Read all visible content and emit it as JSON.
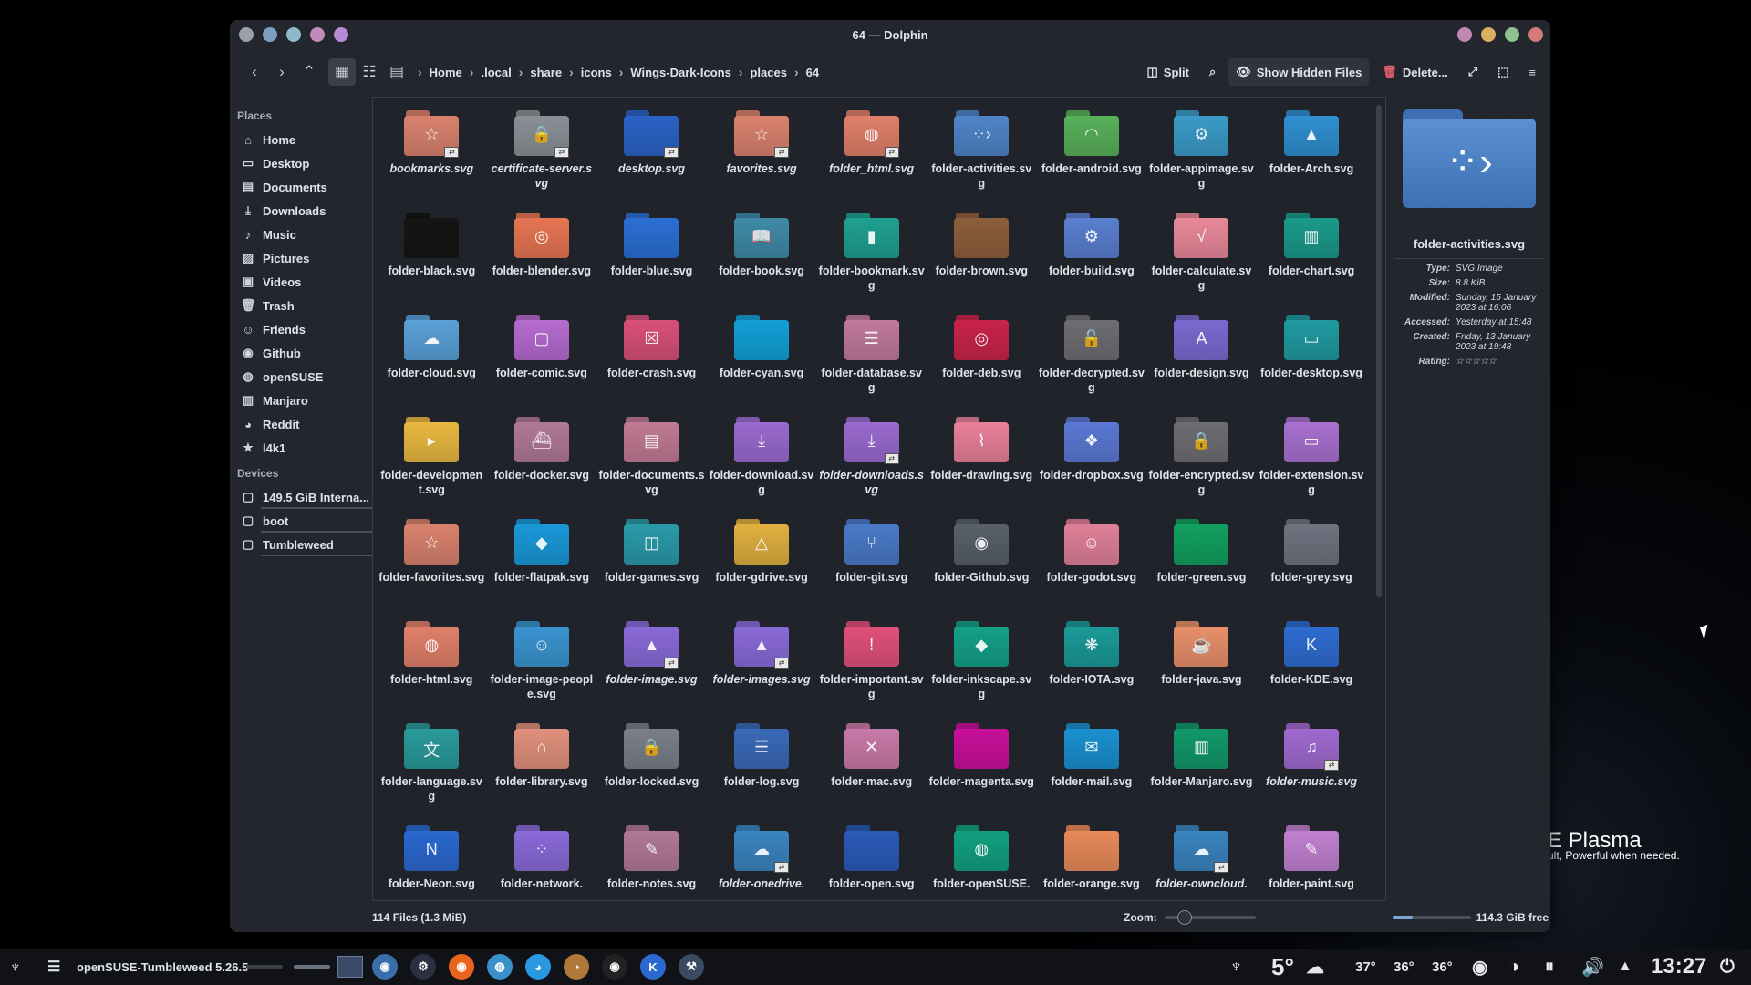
{
  "window": {
    "title": "64 — Dolphin",
    "dots": [
      "#9aa0a8",
      "#7d9fc2",
      "#8fb9c9",
      "#c08bb8",
      "#b48ad9"
    ],
    "controls": [
      "#c088b3",
      "#d8b060",
      "#8fc08f",
      "#d47a7a"
    ]
  },
  "toolbar": {
    "breadcrumbs": [
      "Home",
      ".local",
      "share",
      "icons",
      "Wings-Dark-Icons",
      "places",
      "64"
    ],
    "split": "Split",
    "hidden": "Show Hidden Files",
    "delete": "Delete..."
  },
  "sidebar": {
    "places_header": "Places",
    "places": [
      {
        "label": "Home",
        "icon": "⌂",
        "icon_name": "home-icon"
      },
      {
        "label": "Desktop",
        "icon": "▭",
        "icon_name": "desktop-icon"
      },
      {
        "label": "Documents",
        "icon": "▤",
        "icon_name": "documents-icon"
      },
      {
        "label": "Downloads",
        "icon": "⤓",
        "icon_name": "download-icon"
      },
      {
        "label": "Music",
        "icon": "♪",
        "icon_name": "music-icon"
      },
      {
        "label": "Pictures",
        "icon": "▨",
        "icon_name": "pictures-icon"
      },
      {
        "label": "Videos",
        "icon": "▣",
        "icon_name": "videos-icon"
      },
      {
        "label": "Trash",
        "icon": "🗑",
        "icon_name": "trash-icon"
      },
      {
        "label": "Friends",
        "icon": "☺",
        "icon_name": "friends-icon"
      },
      {
        "label": "Github",
        "icon": "◉",
        "icon_name": "github-icon"
      },
      {
        "label": "openSUSE",
        "icon": "◍",
        "icon_name": "opensuse-icon"
      },
      {
        "label": "Manjaro",
        "icon": "▥",
        "icon_name": "manjaro-icon"
      },
      {
        "label": "Reddit",
        "icon": "◕",
        "icon_name": "reddit-icon"
      },
      {
        "label": "l4k1",
        "icon": "★",
        "icon_name": "star-icon"
      }
    ],
    "devices_header": "Devices",
    "devices": [
      {
        "label": "149.5 GiB Interna...",
        "icon": "▢",
        "icon_name": "drive-icon"
      },
      {
        "label": "boot",
        "icon": "▢",
        "icon_name": "drive-icon"
      },
      {
        "label": "Tumbleweed",
        "icon": "▢",
        "icon_name": "drive-icon"
      }
    ]
  },
  "files": [
    {
      "name": "bookmarks.svg",
      "color": "#d9826e",
      "glyph": "☆",
      "link": true,
      "italic": true
    },
    {
      "name": "certificate-server.svg",
      "color": "#8a9096",
      "glyph": "🔒",
      "link": true,
      "italic": true
    },
    {
      "name": "desktop.svg",
      "color": "#2a63c6",
      "glyph": "",
      "link": true,
      "italic": true
    },
    {
      "name": "favorites.svg",
      "color": "#d9826e",
      "glyph": "☆",
      "link": true,
      "italic": true
    },
    {
      "name": "folder_html.svg",
      "color": "#e0806a",
      "glyph": "◍",
      "link": true,
      "italic": true
    },
    {
      "name": "folder-activities.svg",
      "color": "#4f84c8",
      "glyph": "⁘›",
      "link": false,
      "italic": false
    },
    {
      "name": "folder-android.svg",
      "color": "#58b05a",
      "glyph": "◠",
      "link": false,
      "italic": false
    },
    {
      "name": "folder-appimage.svg",
      "color": "#3a9bc6",
      "glyph": "⚙",
      "link": false,
      "italic": false
    },
    {
      "name": "folder-Arch.svg",
      "color": "#2f8fd0",
      "glyph": "▲",
      "link": false,
      "italic": false
    },
    {
      "name": "folder-black.svg",
      "color": "#151515",
      "glyph": "",
      "link": false,
      "italic": false
    },
    {
      "name": "folder-blender.svg",
      "color": "#e67552",
      "glyph": "◎",
      "link": false,
      "italic": false
    },
    {
      "name": "folder-blue.svg",
      "color": "#2b6fd4",
      "glyph": "",
      "link": false,
      "italic": false
    },
    {
      "name": "folder-book.svg",
      "color": "#3f8aa6",
      "glyph": "📖",
      "link": false,
      "italic": false
    },
    {
      "name": "folder-bookmark.svg",
      "color": "#1fa090",
      "glyph": "▮",
      "link": false,
      "italic": false
    },
    {
      "name": "folder-brown.svg",
      "color": "#8d5f3c",
      "glyph": "",
      "link": false,
      "italic": false
    },
    {
      "name": "folder-build.svg",
      "color": "#5a7fd0",
      "glyph": "⚙",
      "link": false,
      "italic": false
    },
    {
      "name": "folder-calculate.svg",
      "color": "#e8889a",
      "glyph": "√",
      "link": false,
      "italic": false
    },
    {
      "name": "folder-chart.svg",
      "color": "#1a9a8a",
      "glyph": "▥",
      "link": false,
      "italic": false
    },
    {
      "name": "folder-cloud.svg",
      "color": "#5aa0d8",
      "glyph": "☁",
      "link": false,
      "italic": false
    },
    {
      "name": "folder-comic.svg",
      "color": "#b56bd0",
      "glyph": "▢",
      "link": false,
      "italic": false
    },
    {
      "name": "folder-crash.svg",
      "color": "#d8507a",
      "glyph": "☒",
      "link": false,
      "italic": false
    },
    {
      "name": "folder-cyan.svg",
      "color": "#12a0d6",
      "glyph": "",
      "link": false,
      "italic": false
    },
    {
      "name": "folder-database.svg",
      "color": "#c07a9c",
      "glyph": "☰",
      "link": false,
      "italic": false
    },
    {
      "name": "folder-deb.svg",
      "color": "#c8244a",
      "glyph": "◎",
      "link": false,
      "italic": false
    },
    {
      "name": "folder-decrypted.svg",
      "color": "#6e6e72",
      "glyph": "🔓",
      "link": false,
      "italic": false
    },
    {
      "name": "folder-design.svg",
      "color": "#7a6ad0",
      "glyph": "A",
      "link": false,
      "italic": false
    },
    {
      "name": "folder-desktop.svg",
      "color": "#1f9aa0",
      "glyph": "▭",
      "link": false,
      "italic": false
    },
    {
      "name": "folder-development.svg",
      "color": "#e8b840",
      "glyph": "▸",
      "link": false,
      "italic": false
    },
    {
      "name": "folder-docker.svg",
      "color": "#b07898",
      "glyph": "⛴",
      "link": false,
      "italic": false
    },
    {
      "name": "folder-documents.svg",
      "color": "#c07a94",
      "glyph": "▤",
      "link": false,
      "italic": false
    },
    {
      "name": "folder-download.svg",
      "color": "#9a6ad0",
      "glyph": "⤓",
      "link": false,
      "italic": false
    },
    {
      "name": "folder-downloads.svg",
      "color": "#9a6ad0",
      "glyph": "⤓",
      "link": true,
      "italic": true
    },
    {
      "name": "folder-drawing.svg",
      "color": "#e8809a",
      "glyph": "⌇",
      "link": false,
      "italic": false
    },
    {
      "name": "folder-dropbox.svg",
      "color": "#5a78d4",
      "glyph": "❖",
      "link": false,
      "italic": false
    },
    {
      "name": "folder-encrypted.svg",
      "color": "#6e6e72",
      "glyph": "🔒",
      "link": false,
      "italic": false
    },
    {
      "name": "folder-extension.svg",
      "color": "#a870d0",
      "glyph": "▭",
      "link": false,
      "italic": false
    },
    {
      "name": "folder-favorites.svg",
      "color": "#d9826e",
      "glyph": "☆",
      "link": false,
      "italic": false
    },
    {
      "name": "folder-flatpak.svg",
      "color": "#1a98d8",
      "glyph": "◆",
      "link": false,
      "italic": false
    },
    {
      "name": "folder-games.svg",
      "color": "#2a9aa8",
      "glyph": "◫",
      "link": false,
      "italic": false
    },
    {
      "name": "folder-gdrive.svg",
      "color": "#e0b040",
      "glyph": "△",
      "link": false,
      "italic": false
    },
    {
      "name": "folder-git.svg",
      "color": "#4a7ac8",
      "glyph": "⑂",
      "link": false,
      "italic": false
    },
    {
      "name": "folder-Github.svg",
      "color": "#58606a",
      "glyph": "◉",
      "link": false,
      "italic": false
    },
    {
      "name": "folder-godot.svg",
      "color": "#e08098",
      "glyph": "☺",
      "link": false,
      "italic": false
    },
    {
      "name": "folder-green.svg",
      "color": "#12a060",
      "glyph": "",
      "link": false,
      "italic": false
    },
    {
      "name": "folder-grey.svg",
      "color": "#6e7480",
      "glyph": "",
      "link": false,
      "italic": false
    },
    {
      "name": "folder-html.svg",
      "color": "#e0806a",
      "glyph": "◍",
      "link": false,
      "italic": false
    },
    {
      "name": "folder-image-people.svg",
      "color": "#3a94d0",
      "glyph": "☺",
      "link": false,
      "italic": false
    },
    {
      "name": "folder-image.svg",
      "color": "#8a6ad8",
      "glyph": "▲",
      "link": true,
      "italic": true
    },
    {
      "name": "folder-images.svg",
      "color": "#8a6ad8",
      "glyph": "▲",
      "link": true,
      "italic": true
    },
    {
      "name": "folder-important.svg",
      "color": "#e0507a",
      "glyph": "!",
      "link": false,
      "italic": false
    },
    {
      "name": "folder-inkscape.svg",
      "color": "#14a088",
      "glyph": "◆",
      "link": false,
      "italic": false
    },
    {
      "name": "folder-IOTA.svg",
      "color": "#1a9a98",
      "glyph": "❋",
      "link": false,
      "italic": false
    },
    {
      "name": "folder-java.svg",
      "color": "#e8906a",
      "glyph": "☕",
      "link": false,
      "italic": false
    },
    {
      "name": "folder-KDE.svg",
      "color": "#2e6cd0",
      "glyph": "K",
      "link": false,
      "italic": false
    },
    {
      "name": "folder-language.svg",
      "color": "#2a9a9a",
      "glyph": "文",
      "link": false,
      "italic": false
    },
    {
      "name": "folder-library.svg",
      "color": "#e0907c",
      "glyph": "⌂",
      "link": false,
      "italic": false
    },
    {
      "name": "folder-locked.svg",
      "color": "#7a8088",
      "glyph": "🔒",
      "link": false,
      "italic": false
    },
    {
      "name": "folder-log.svg",
      "color": "#3a6ab8",
      "glyph": "☰",
      "link": false,
      "italic": false
    },
    {
      "name": "folder-mac.svg",
      "color": "#c87aa8",
      "glyph": "✕",
      "link": false,
      "italic": false
    },
    {
      "name": "folder-magenta.svg",
      "color": "#c8109a",
      "glyph": "",
      "link": false,
      "italic": false
    },
    {
      "name": "folder-mail.svg",
      "color": "#1a90d0",
      "glyph": "✉",
      "link": false,
      "italic": false
    },
    {
      "name": "folder-Manjaro.svg",
      "color": "#12986a",
      "glyph": "▥",
      "link": false,
      "italic": false
    },
    {
      "name": "folder-music.svg",
      "color": "#a06ad0",
      "glyph": "♫",
      "link": true,
      "italic": true
    },
    {
      "name": "folder-Neon.svg",
      "color": "#2a68d0",
      "glyph": "N",
      "link": false,
      "italic": false
    },
    {
      "name": "folder-network.",
      "color": "#8a6ad8",
      "glyph": "⁘",
      "link": false,
      "italic": false
    },
    {
      "name": "folder-notes.svg",
      "color": "#b07898",
      "glyph": "✎",
      "link": false,
      "italic": false
    },
    {
      "name": "folder-onedrive.",
      "color": "#3a84c0",
      "glyph": "☁",
      "link": true,
      "italic": true
    },
    {
      "name": "folder-open.svg",
      "color": "#2a5ab8",
      "glyph": "",
      "link": false,
      "italic": false
    },
    {
      "name": "folder-openSUSE.",
      "color": "#12a080",
      "glyph": "◍",
      "link": false,
      "italic": false
    },
    {
      "name": "folder-orange.svg",
      "color": "#e88a5a",
      "glyph": "",
      "link": false,
      "italic": false
    },
    {
      "name": "folder-owncloud.",
      "color": "#3a84c0",
      "glyph": "☁",
      "link": true,
      "italic": true
    },
    {
      "name": "folder-paint.svg",
      "color": "#c080d0",
      "glyph": "✎",
      "link": false,
      "italic": false
    }
  ],
  "info": {
    "name": "folder-activities.svg",
    "rows": [
      {
        "k": "Type:",
        "v": "SVG Image"
      },
      {
        "k": "Size:",
        "v": "8.8 KiB"
      },
      {
        "k": "Modified:",
        "v": "Sunday, 15 January 2023 at 16:06"
      },
      {
        "k": "Accessed:",
        "v": "Yesterday at 15:48"
      },
      {
        "k": "Created:",
        "v": "Friday, 13 January 2023 at 19:48"
      },
      {
        "k": "Rating:",
        "v": "☆☆☆☆☆"
      }
    ]
  },
  "status": {
    "count": "114 Files (1.3 MiB)",
    "zoom_label": "Zoom:",
    "free": "114.3 GiB free"
  },
  "desktop": {
    "plasma": "E Plasma",
    "plasma_sub": "ult, Powerful when  needed."
  },
  "taskbar": {
    "task_title": "openSUSE-Tumbleweed 5.26.5",
    "apps": [
      {
        "name": "dolphin-app-icon",
        "color": "#3a6ea8",
        "glyph": "◉"
      },
      {
        "name": "settings-app-icon",
        "color": "#2a3040",
        "glyph": "⚙"
      },
      {
        "name": "firefox-app-icon",
        "color": "#e8641c",
        "glyph": "◉"
      },
      {
        "name": "browser-app-icon",
        "color": "#3a90c8",
        "glyph": "◍"
      },
      {
        "name": "discover-app-icon",
        "color": "#2a98e0",
        "glyph": "◕"
      },
      {
        "name": "gimp-app-icon",
        "color": "#b07838",
        "glyph": "◔"
      },
      {
        "name": "github-app-icon",
        "color": "#222",
        "glyph": "◉"
      },
      {
        "name": "kde-app-icon",
        "color": "#2a6ad0",
        "glyph": "K"
      },
      {
        "name": "system-app-icon",
        "color": "#3a4a60",
        "glyph": "⚒"
      }
    ],
    "weather": "5°",
    "temps": [
      "37°",
      "36°",
      "36°"
    ],
    "clock": "13:27"
  }
}
